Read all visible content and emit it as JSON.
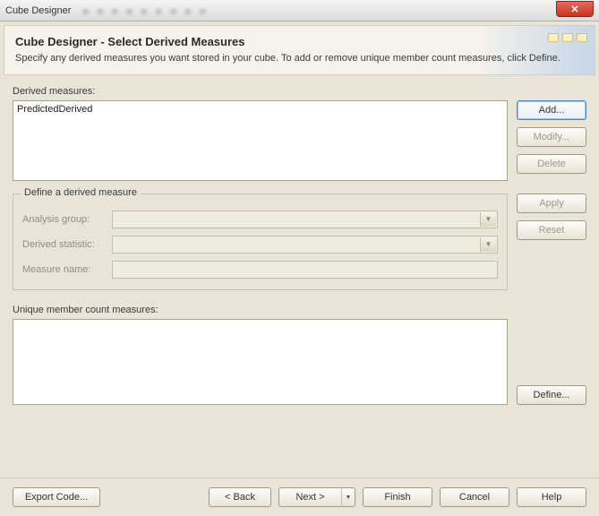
{
  "window": {
    "title": "Cube Designer",
    "close_glyph": "✕"
  },
  "header": {
    "title": "Cube Designer - Select Derived Measures",
    "description": "Specify any derived measures you want stored in your cube. To add or remove unique member count measures, click Define."
  },
  "derived": {
    "label": "Derived measures:",
    "items": [
      "PredictedDerived"
    ]
  },
  "buttons": {
    "add": "Add...",
    "modify": "Modify...",
    "delete": "Delete",
    "apply": "Apply",
    "reset": "Reset",
    "define": "Define..."
  },
  "define_group": {
    "legend": "Define a derived measure",
    "analysis_group_label": "Analysis group:",
    "derived_stat_label": "Derived statistic:",
    "measure_name_label": "Measure name:",
    "analysis_group_value": "",
    "derived_stat_value": "",
    "measure_name_value": ""
  },
  "unique": {
    "label": "Unique member count measures:"
  },
  "footer": {
    "export_code": "Export Code...",
    "back": "< Back",
    "next": "Next >",
    "finish": "Finish",
    "cancel": "Cancel",
    "help": "Help"
  }
}
